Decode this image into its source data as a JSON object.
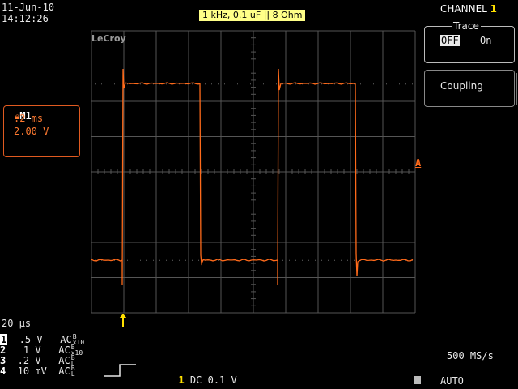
{
  "header": {
    "date": "11-Jun-10",
    "time": "14:12:26",
    "annotation": "1 kHz, 0.1 uF || 8 Ohm",
    "logo": "LeCroy"
  },
  "menu": {
    "title": "CHANNEL",
    "channel_number": "1",
    "trace": {
      "label": "Trace",
      "off": "OFF",
      "on": "On",
      "selected": "OFF"
    },
    "coupling": {
      "label": "Coupling"
    }
  },
  "math_trace": {
    "name": "M1",
    "timebase": ".2 ms",
    "volts": "2.00 V"
  },
  "markers": {
    "trigger_level": "A"
  },
  "timebase": "20 μs",
  "channels": [
    {
      "num": "1",
      "volts": ".5",
      "unit": "V",
      "coupling": "AC",
      "top": "B",
      "sub": "x10",
      "highlight": true
    },
    {
      "num": "2",
      "volts": "1",
      "unit": "V",
      "coupling": "AC",
      "top": "B",
      "sub": "x10",
      "highlight": false
    },
    {
      "num": "3",
      "volts": ".2",
      "unit": "V",
      "coupling": "AC",
      "top": "B",
      "sub": "L",
      "highlight": false
    },
    {
      "num": "4",
      "volts": "10",
      "unit": "mV",
      "coupling": "AC",
      "top": "B",
      "sub": "L",
      "highlight": false
    }
  ],
  "trigger": {
    "source": "1",
    "coupling": "DC",
    "level": "0.1 V",
    "mode": "AUTO"
  },
  "sample_rate": "500 MS/s",
  "colors": {
    "trace": "#ff6a1a",
    "grid": "#555555",
    "trigger_marker": "#ffe000",
    "annotation_bg": "#ffff88"
  }
}
